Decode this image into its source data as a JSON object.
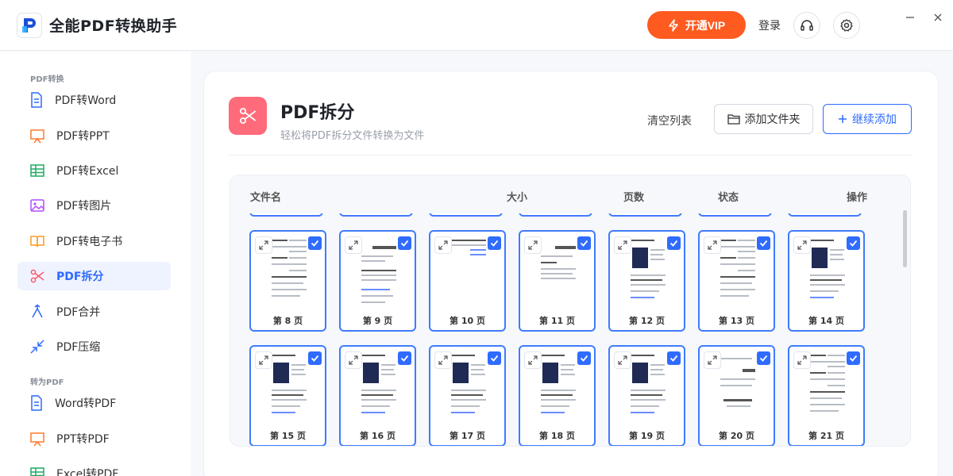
{
  "app": {
    "title": "全能PDF转换助手"
  },
  "header": {
    "vip_label": "开通VIP",
    "login_label": "登录"
  },
  "sidebar": {
    "section1": "PDF转换",
    "section2": "转为PDF",
    "items": [
      {
        "label": "PDF转Word"
      },
      {
        "label": "PDF转PPT"
      },
      {
        "label": "PDF转Excel"
      },
      {
        "label": "PDF转图片"
      },
      {
        "label": "PDF转电子书"
      },
      {
        "label": "PDF拆分"
      },
      {
        "label": "PDF合并"
      },
      {
        "label": "PDF压缩"
      },
      {
        "label": "Word转PDF"
      },
      {
        "label": "PPT转PDF"
      },
      {
        "label": "Excel转PDF"
      }
    ]
  },
  "feature": {
    "title": "PDF拆分",
    "subtitle": "轻松将PDF拆分文件转换为文件",
    "clear_label": "清空列表",
    "add_folder_label": "添加文件夹",
    "continue_add_label": "继续添加"
  },
  "table": {
    "headers": [
      "文件名",
      "大小",
      "页数",
      "状态",
      "操作"
    ]
  },
  "pages": {
    "row1": [
      "第 8 页",
      "第 9 页",
      "第 10 页",
      "第 11 页",
      "第 12 页",
      "第 13 页",
      "第 14 页"
    ],
    "row2": [
      "第 15 页",
      "第 16 页",
      "第 17 页",
      "第 18 页",
      "第 19 页",
      "第 20 页",
      "第 21 页"
    ]
  },
  "colors": {
    "accent": "#2f6bff",
    "vip": "#ff5a1f",
    "feature_icon": "#ff6b7a"
  }
}
